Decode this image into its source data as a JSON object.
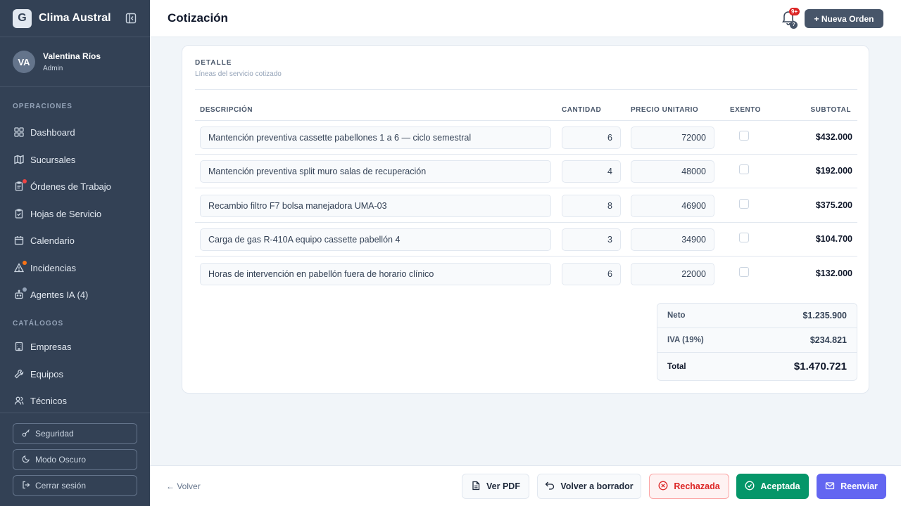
{
  "brand": {
    "logo_letter": "G",
    "name": "Clima Austral"
  },
  "user": {
    "initials": "VA",
    "name": "Valentina Ríos",
    "role": "Admin"
  },
  "sidebar": {
    "sections": [
      {
        "label": "OPERACIONES"
      },
      {
        "label": "CATÁLOGOS"
      }
    ],
    "items": [
      {
        "label": "Dashboard",
        "icon": "grid-icon"
      },
      {
        "label": "Sucursales",
        "icon": "map-icon"
      },
      {
        "label": "Órdenes de Trabajo",
        "icon": "clipboard-icon",
        "badge_color": "#ef4444"
      },
      {
        "label": "Hojas de Servicio",
        "icon": "clipboard-check-icon"
      },
      {
        "label": "Calendario",
        "icon": "calendar-icon"
      },
      {
        "label": "Incidencias",
        "icon": "alert-triangle-icon",
        "badge_color": "#f97316"
      },
      {
        "label": "Agentes IA (4)",
        "icon": "bot-icon",
        "badge_color": "#94a3b8"
      },
      {
        "label": "Empresas",
        "icon": "building-icon"
      },
      {
        "label": "Equipos",
        "icon": "wrench-icon"
      },
      {
        "label": "Técnicos",
        "icon": "users-icon"
      }
    ],
    "bottom": [
      {
        "label": "Seguridad",
        "icon": "key-icon"
      },
      {
        "label": "Modo Oscuro",
        "icon": "moon-icon"
      },
      {
        "label": "Cerrar sesión",
        "icon": "logout-icon"
      }
    ]
  },
  "header": {
    "title": "Cotización",
    "notifications_badge": "9+",
    "help_glyph": "?",
    "new_order_label": "+ Nueva Orden"
  },
  "detail": {
    "heading": "DETALLE",
    "subheading": "Líneas del servicio cotizado",
    "columns": [
      "DESCRIPCIÓN",
      "CANTIDAD",
      "PRECIO UNITARIO",
      "EXENTO",
      "SUBTOTAL"
    ],
    "rows": [
      {
        "description": "Mantención preventiva cassette pabellones 1 a 6 — ciclo semestral",
        "quantity": "6",
        "unit_price": "72000",
        "exempt": false,
        "subtotal": "$432.000"
      },
      {
        "description": "Mantención preventiva split muro salas de recuperación",
        "quantity": "4",
        "unit_price": "48000",
        "exempt": false,
        "subtotal": "$192.000"
      },
      {
        "description": "Recambio filtro F7 bolsa manejadora UMA-03",
        "quantity": "8",
        "unit_price": "46900",
        "exempt": false,
        "subtotal": "$375.200"
      },
      {
        "description": "Carga de gas R-410A equipo cassette pabellón 4",
        "quantity": "3",
        "unit_price": "34900",
        "exempt": false,
        "subtotal": "$104.700"
      },
      {
        "description": "Horas de intervención en pabellón fuera de horario clínico",
        "quantity": "6",
        "unit_price": "22000",
        "exempt": false,
        "subtotal": "$132.000"
      }
    ]
  },
  "totals": {
    "net_label": "Neto",
    "net_value": "$1.235.900",
    "tax_label": "IVA (19%)",
    "tax_value": "$234.821",
    "total_label": "Total",
    "total_value": "$1.470.721"
  },
  "footer": {
    "back_label": "← Volver",
    "pdf_label": "Ver PDF",
    "draft_label": "Volver a borrador",
    "reject_label": "Rechazada",
    "accept_label": "Aceptada",
    "resend_label": "Reenviar"
  }
}
